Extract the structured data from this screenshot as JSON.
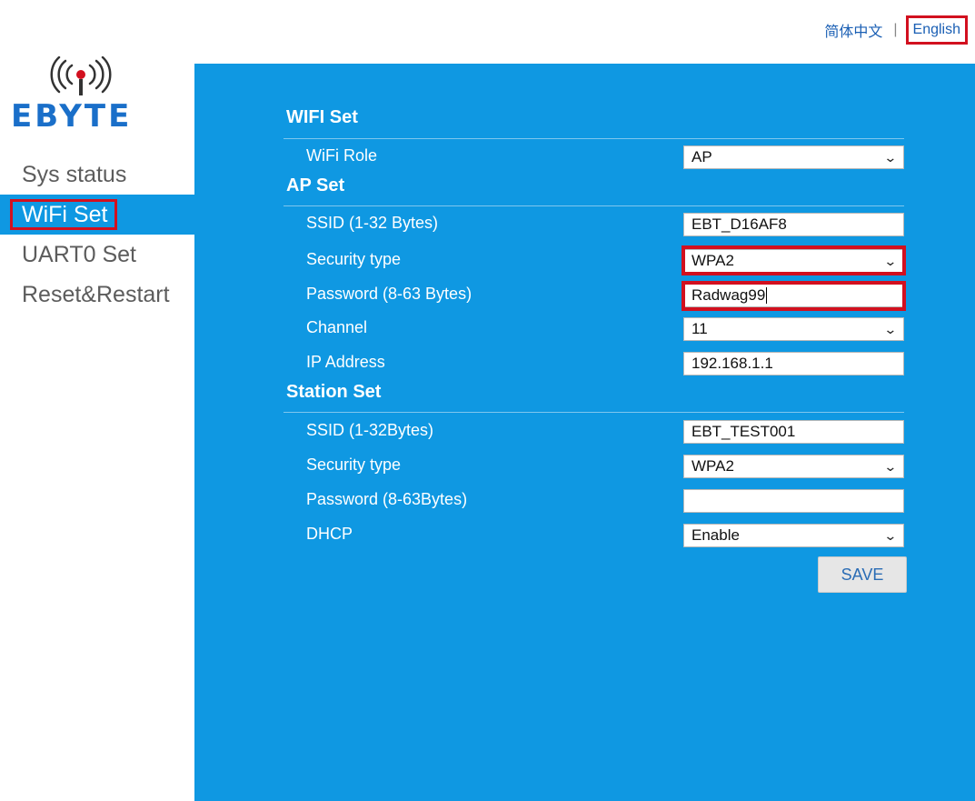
{
  "lang": {
    "chinese": "简体中文",
    "separator": "|",
    "english": "English"
  },
  "logo": {
    "text": "EBYTE",
    "icon": "wifi-broadcast-icon"
  },
  "sidebar": {
    "items": [
      {
        "label": "Sys status"
      },
      {
        "label": "WiFi Set"
      },
      {
        "label": "UART0 Set"
      },
      {
        "label": "Reset&Restart"
      }
    ],
    "active_index": 1
  },
  "wifi_set": {
    "title": "WIFI Set",
    "role_label": "WiFi Role",
    "role_value": "AP"
  },
  "ap_set": {
    "title": "AP Set",
    "ssid_label": "SSID (1-32 Bytes)",
    "ssid_value": "EBT_D16AF8",
    "security_label": "Security type",
    "security_value": "WPA2",
    "password_label": "Password (8-63 Bytes)",
    "password_value": "Radwag99",
    "channel_label": "Channel",
    "channel_value": "11",
    "ip_label": "IP Address",
    "ip_value": "192.168.1.1"
  },
  "station_set": {
    "title": "Station Set",
    "ssid_label": "SSID (1-32Bytes)",
    "ssid_value": "EBT_TEST001",
    "security_label": "Security type",
    "security_value": "WPA2",
    "password_label": "Password (8-63Bytes)",
    "password_value": "",
    "dhcp_label": "DHCP",
    "dhcp_value": "Enable"
  },
  "save_label": "SAVE",
  "colors": {
    "panel": "#0f98e2",
    "highlight": "#d2101f",
    "logo": "#1a6fc9"
  }
}
